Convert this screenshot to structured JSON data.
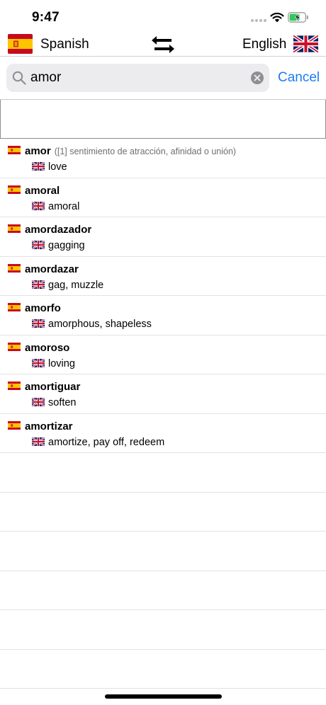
{
  "status_bar": {
    "time": "9:47"
  },
  "language_bar": {
    "source_language": "Spanish",
    "target_language": "English"
  },
  "search": {
    "query": "amor",
    "cancel_label": "Cancel"
  },
  "results": [
    {
      "term": "amor",
      "note": "([1] sentimiento de atracción, afinidad o unión)",
      "translation": "love"
    },
    {
      "term": "amoral",
      "note": "",
      "translation": "amoral"
    },
    {
      "term": "amordazador",
      "note": "",
      "translation": "gagging"
    },
    {
      "term": "amordazar",
      "note": "",
      "translation": "gag, muzzle"
    },
    {
      "term": "amorfo",
      "note": "",
      "translation": "amorphous, shapeless"
    },
    {
      "term": "amoroso",
      "note": "",
      "translation": "loving"
    },
    {
      "term": "amortiguar",
      "note": "",
      "translation": "soften"
    },
    {
      "term": "amortizar",
      "note": "",
      "translation": "amortize, pay off, redeem"
    }
  ],
  "colors": {
    "accent": "#1a7cf5",
    "search_field_bg": "#ececee",
    "separator": "#e2e2e6"
  },
  "icons": {
    "swap": "swap-arrows-icon",
    "search": "magnifier-icon",
    "clear": "clear-x-circle-icon",
    "source_flag": "spain-flag-icon",
    "target_flag": "uk-flag-icon"
  }
}
